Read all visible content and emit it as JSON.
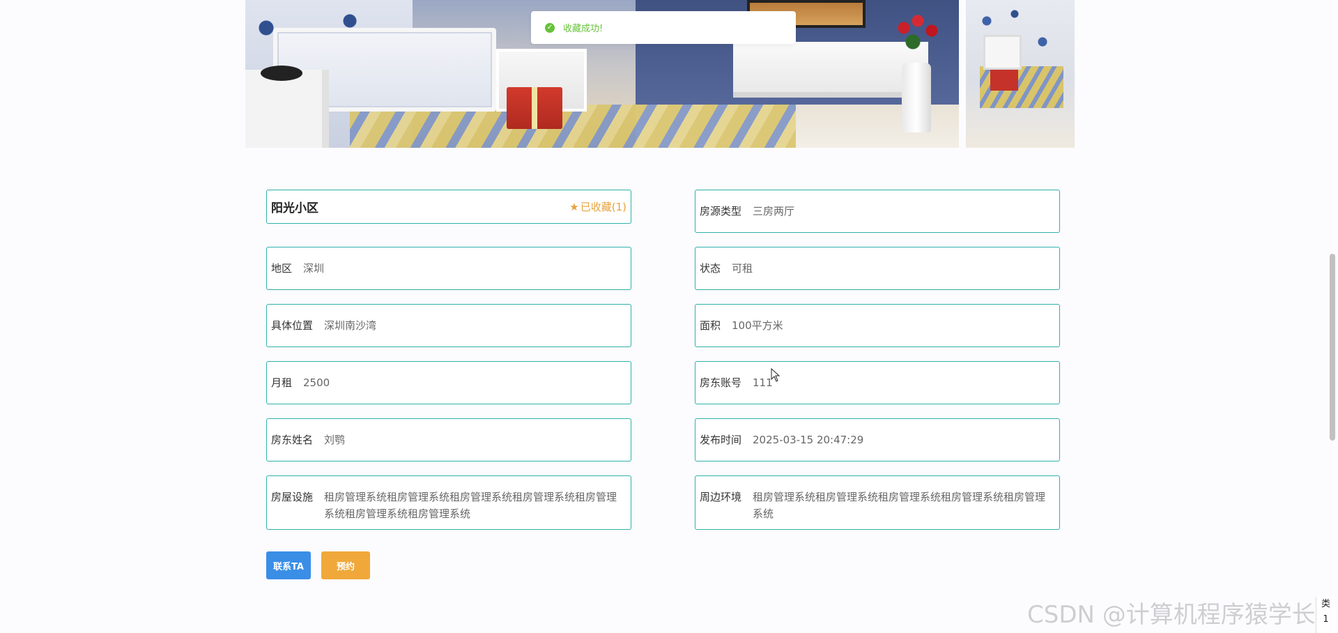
{
  "toast": {
    "message": "收藏成功!"
  },
  "house": {
    "title": "阳光小区",
    "favorite_label": "已收藏(1)",
    "fields_left": [
      {
        "label": "地区",
        "value": "深圳"
      },
      {
        "label": "具体位置",
        "value": "深圳南沙湾"
      },
      {
        "label": "月租",
        "value": "2500"
      },
      {
        "label": "房东姓名",
        "value": "刘鹗"
      },
      {
        "label": "房屋设施",
        "value": "租房管理系统租房管理系统租房管理系统租房管理系统租房管理系统租房管理系统租房管理系统"
      }
    ],
    "fields_right": [
      {
        "label": "房源类型",
        "value": "三房两厅"
      },
      {
        "label": "状态",
        "value": "可租"
      },
      {
        "label": "面积",
        "value": "100平方米"
      },
      {
        "label": "房东账号",
        "value": "111"
      },
      {
        "label": "发布时间",
        "value": "2025-03-15 20:47:29"
      },
      {
        "label": "周边环境",
        "value": "租房管理系统租房管理系统租房管理系统租房管理系统租房管理系统"
      }
    ]
  },
  "actions": {
    "contact_label": "联系TA",
    "book_label": "预约"
  },
  "watermark": "CSDN @计算机程序猿学长",
  "corner_widget": {
    "line1": "类",
    "line2": "1"
  },
  "colors": {
    "border": "#2fb1a9",
    "favorite": "#e6a23c",
    "contact": "#3a8ee6",
    "book": "#f0a83a",
    "toast": "#67c23a"
  }
}
